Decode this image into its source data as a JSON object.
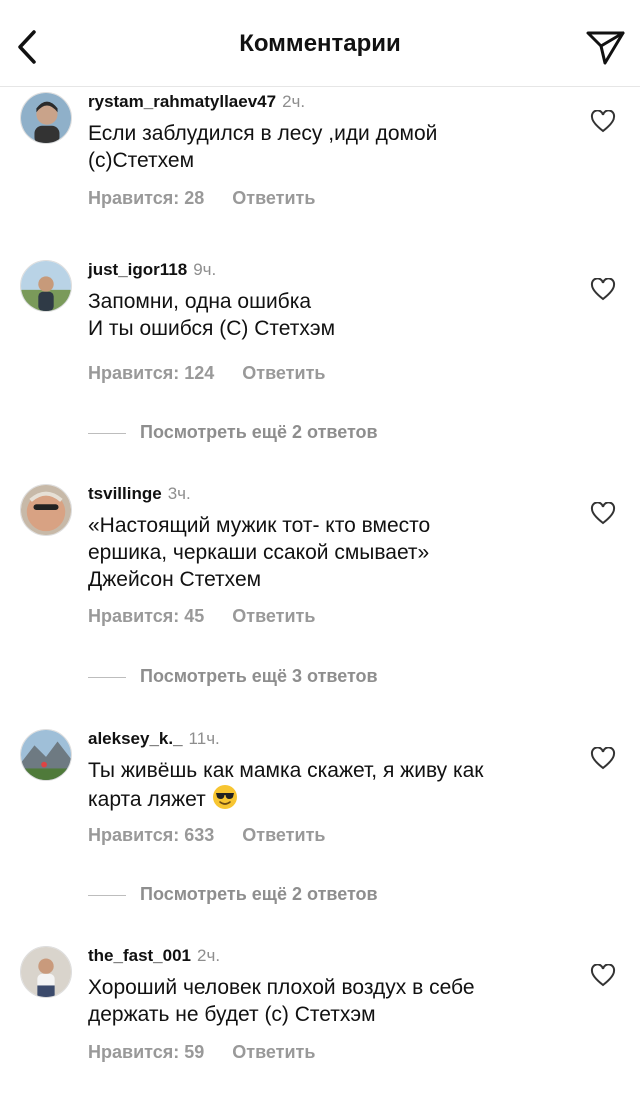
{
  "header": {
    "title": "Комментарии",
    "back_icon": "chevron-left-icon",
    "send_icon": "paper-plane-icon"
  },
  "comments": [
    {
      "username": "rystam_rahmatyllaev47",
      "time": "2ч.",
      "text": "Если заблудился в лесу ,иди домой\n(с)Стетхем",
      "likes": "Нравится: 28",
      "reply": "Ответить"
    },
    {
      "username": "just_igor118",
      "time": "9ч.",
      "text": "Запомни, одна ошибка\nИ ты ошибся (С) Стетхэм",
      "likes": "Нравится: 124",
      "reply": "Ответить"
    },
    {
      "username": "tsvillinge",
      "time": "3ч.",
      "text": "«Настоящий мужик тот- кто вместо\nершика, черкаши ссакой смывает»\nДжейсон Стетхем",
      "likes": "Нравится: 45",
      "reply": "Ответить"
    },
    {
      "username": "aleksey_k._",
      "time": "11ч.",
      "text": "Ты живёшь как мамка скажет, я живу как\nкарта ляжет",
      "emoji": "smiling-face-with-sunglasses",
      "likes": "Нравится: 633",
      "reply": "Ответить"
    },
    {
      "username": "the_fast_001",
      "time": "2ч.",
      "text": "Хороший человек плохой воздух в себе\nдержать не будет (с) Стетхэм",
      "likes": "Нравится: 59",
      "reply": "Ответить"
    }
  ],
  "more_replies": [
    "Посмотреть ещё 2 ответов",
    "Посмотреть ещё 3 ответов",
    "Посмотреть ещё 2 ответов"
  ],
  "colors": {
    "text": "#111111",
    "secondary": "#8e8e8e",
    "meta": "#999999",
    "divider": "#e6e6e6"
  }
}
